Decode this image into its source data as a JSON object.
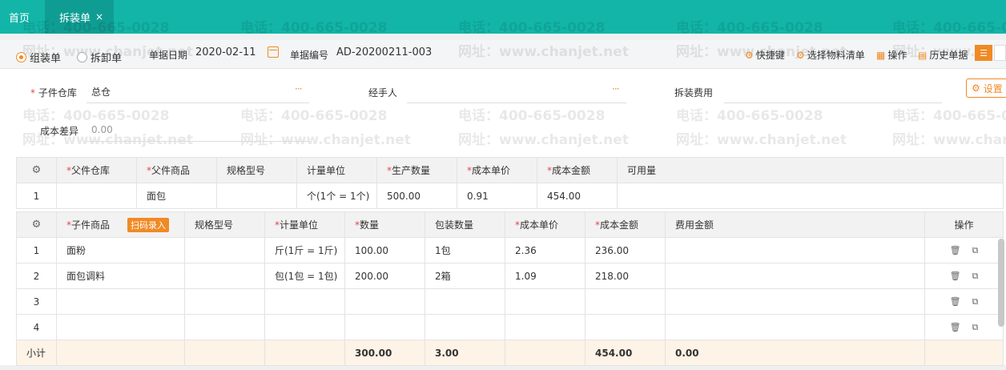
{
  "tabs": {
    "home": "首页",
    "active": "拆装单",
    "close": "×"
  },
  "mode": {
    "assemble": "组装单",
    "disassemble": "拆卸单"
  },
  "header": {
    "date_label": "单据日期",
    "date_value": "2020-02-11",
    "code_label": "单据编号",
    "code_value": "AD-20200211-003"
  },
  "toolbar": [
    {
      "label": "快捷键",
      "icon": "gear-icon"
    },
    {
      "label": "选择物料清单",
      "icon": "gear-icon"
    },
    {
      "label": "操作",
      "icon": "grid-icon"
    },
    {
      "label": "历史单据",
      "icon": "history-icon"
    }
  ],
  "form": {
    "warehouse_label": "子件仓库",
    "warehouse_value": "总仓",
    "handler_label": "经手人",
    "fee_label": "拆装费用",
    "diff_label": "成本差异",
    "diff_value": "0.00",
    "settings": "设置",
    "more": "···"
  },
  "watermark": {
    "phone": "电话：400-665-0028",
    "site": "网址：www.chanjet.net"
  },
  "parent_table": {
    "headers": [
      "父件仓库",
      "父件商品",
      "规格型号",
      "计量单位",
      "生产数量",
      "成本单价",
      "成本金额",
      "可用量"
    ],
    "rows": [
      {
        "idx": "1",
        "warehouse": "",
        "product": "面包",
        "spec": "",
        "unit": "个(1个 = 1个)",
        "qty": "500.00",
        "price": "0.91",
        "amount": "454.00",
        "avail": ""
      }
    ]
  },
  "child_table": {
    "headers": [
      "子件商品",
      "规格型号",
      "计量单位",
      "数量",
      "包装数量",
      "成本单价",
      "成本金额",
      "费用金额",
      "操作"
    ],
    "scan_label": "扫码录入",
    "rows": [
      {
        "idx": "1",
        "product": "面粉",
        "spec": "",
        "unit": "斤(1斤 = 1斤)",
        "qty": "100.00",
        "pack": "1包",
        "price": "2.36",
        "amount": "236.00",
        "fee": ""
      },
      {
        "idx": "2",
        "product": "面包调料",
        "spec": "",
        "unit": "包(1包 = 1包)",
        "qty": "200.00",
        "pack": "2箱",
        "price": "1.09",
        "amount": "218.00",
        "fee": ""
      },
      {
        "idx": "3",
        "product": "",
        "spec": "",
        "unit": "",
        "qty": "",
        "pack": "",
        "price": "",
        "amount": "",
        "fee": ""
      },
      {
        "idx": "4",
        "product": "",
        "spec": "",
        "unit": "",
        "qty": "",
        "pack": "",
        "price": "",
        "amount": "",
        "fee": ""
      }
    ],
    "subtotal": {
      "label": "小计",
      "qty": "300.00",
      "pack": "3.00",
      "amount": "454.00",
      "fee": "0.00"
    }
  },
  "colors": {
    "brand": "#12b5a8",
    "accent": "#f08a24",
    "required": "#e5484d"
  }
}
